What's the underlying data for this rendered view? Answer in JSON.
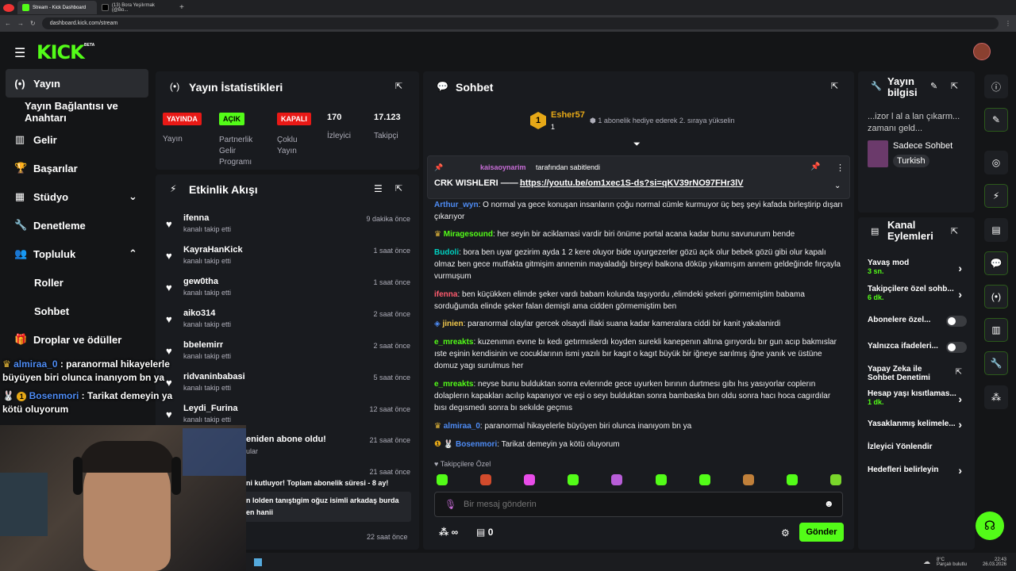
{
  "browser": {
    "tabs": [
      {
        "label": "Stream - Kick Dashboard"
      },
      {
        "label": "(13) Bora Yeşilırmak (@Bo..."
      }
    ],
    "url": "dashboard.kick.com/stream"
  },
  "header": {
    "logo": "KICK",
    "beta": "BETA"
  },
  "sidebar": {
    "items": [
      {
        "label": "Yayın",
        "icon": "broadcast-icon"
      },
      {
        "label": "Yayın Bağlantısı ve Anahtarı"
      },
      {
        "label": "Gelir",
        "icon": "chart-icon"
      },
      {
        "label": "Başarılar",
        "icon": "trophy-icon"
      },
      {
        "label": "Stüdyo",
        "icon": "layout-icon"
      },
      {
        "label": "Denetleme",
        "icon": "wrench-icon"
      },
      {
        "label": "Topluluk",
        "icon": "people-icon"
      },
      {
        "label": "Roller"
      },
      {
        "label": "Sohbet"
      },
      {
        "label": "Droplar ve ödüller",
        "icon": "gift-icon"
      }
    ]
  },
  "stats": {
    "title": "Yayın İstatistikleri",
    "items": [
      {
        "badge": "YAYINDA",
        "label": "Yayın"
      },
      {
        "badge": "AÇIK",
        "label": "Partnerlik Gelir Programı"
      },
      {
        "badge": "KAPALI",
        "label": "Çoklu Yayın"
      },
      {
        "value": "170",
        "label": "İzleyici"
      },
      {
        "value": "17.123",
        "label": "Takipçi"
      }
    ]
  },
  "activity": {
    "title": "Etkinlik Akışı",
    "items": [
      {
        "name": "ifenna",
        "sub": "kanalı takip etti",
        "time": "9 dakika önce"
      },
      {
        "name": "KayraHanKick",
        "sub": "kanalı takip etti",
        "time": "1 saat önce"
      },
      {
        "name": "gew0tha",
        "sub": "kanalı takip etti",
        "time": "1 saat önce"
      },
      {
        "name": "aiko314",
        "sub": "kanalı takip etti",
        "time": "2 saat önce"
      },
      {
        "name": "bbelemirr",
        "sub": "kanalı takip etti",
        "time": "2 saat önce"
      },
      {
        "name": "ridvaninbabasi",
        "sub": "kanalı takip etti",
        "time": "5 saat önce"
      },
      {
        "name": "Leydi_Furina",
        "sub": "kanalı takip etti",
        "time": "12 saat önce"
      },
      {
        "name": "eniden abone oldu!",
        "sub": "ular",
        "time": "21 saat önce"
      },
      {
        "name": "ni kutluyor! Toplam abonelik süresi - 8 ay!",
        "sub": "",
        "time": "21 saat önce"
      },
      {
        "name": "n lolden tanıştıgim oğuz isimli arkadaş burda",
        "sub": "en hanii",
        "time": ""
      },
      {
        "name": "",
        "sub": "",
        "time": "22 saat önce"
      }
    ]
  },
  "chat": {
    "title": "Sohbet",
    "top_gifter": {
      "rank": "1",
      "name": "Esher57",
      "count": "1",
      "hint": "1 abonelik hediye ederek 2. sıraya yükselin"
    },
    "pinned": {
      "by": "kaisaoynarim",
      "by_suffix": "tarafından sabitlendi",
      "text": "CRK WISHLERI ——→",
      "link": "https://youtu.be/om1xec1S-ds?si=qKV39rNO97FHr3lV"
    },
    "messages": [
      {
        "user": "Arthur_wyn",
        "color": "#4e8cf5",
        "text": "O normal ya gece konuşan insanların çoğu normal cümle kurmuyor üç beş şeyi kafada birleştirip dışarı çıkarıyor"
      },
      {
        "user": "Miragesound",
        "color": "#53fc18",
        "text": "her seyin bir aciklamasi vardir biri önüme portal acana kadar bunu savunurum bende"
      },
      {
        "user": "Budoli",
        "color": "#00d1c1",
        "text": "bora ben uyar gezirim ayda 1 2 kere oluyor bide uyurgezerler gözü açık olur bebek gözü gibi olur kapalı olmaz ben gece mutfakta gitmişim annemin mayaladığı birşeyi balkona döküp yıkamışım annem geldeğinde fırçayla vurmuşum"
      },
      {
        "user": "ifenna",
        "color": "#ff5b6e",
        "text": "ben küçükken elimde şeker vardı babam kolunda taşıyordu ,elimdeki şekeri görmemiştim babama sorduğumda elinde şeker falan demişti ama cidden görmemiştim ben"
      },
      {
        "user": "jinien",
        "color": "#f2c94c",
        "text": "paranormal olaylar gercek olsaydi illaki suana kadar kameralara ciddi bir kanit yakalanirdi"
      },
      {
        "user": "e_mreakts",
        "color": "#53fc18",
        "text": "kuzenımın evıne bı kedı getırmıslerdı koyden surekli kanepenın altına gırıyordu bır gun acıp bakmıslar ıste eşinin kendisinin ve cocuklarının ismi yazılı bır kagıt o kagıt büyük bir iğneye sarılmış iğne yanık ve üstüne domuz yagı surulmus her"
      },
      {
        "user": "e_mreakts",
        "color": "#53fc18",
        "text": "neyse bunu bulduktan sonra evlerınde gece uyurken bırının durtmesı gıbı hıs yasıyorlar coplerın dolaplerın kapakları acılıp kapanıyor ve eşi o seyı bulduktan sonra bambaska bırı oldu sonra hacı hoca cagırdılar bısı degısmedı sonra bı sekılde geçmıs"
      },
      {
        "user": "almiraa_0",
        "color": "#4e8cf5",
        "text": "paranormal hikayelerle büyüyen biri olunca inanıyom bn ya"
      },
      {
        "user": "Bosenmori",
        "color": "#4e8cf5",
        "text": "Tarikat demeyin ya kötü oluyorum"
      }
    ],
    "followers_only": "Takipçilere Özel",
    "input_placeholder": "Bir mesaj gönderin",
    "points": "∞",
    "store_count": "0",
    "send": "Gönder"
  },
  "stream_info": {
    "title": "Yayın bilgisi",
    "stream_title": "...izor l al a lan çıkarm... zamanı geld...",
    "category": "Sadece Sohbet",
    "tag": "Turkish"
  },
  "actions": {
    "title": "Kanal Eylemleri",
    "items": [
      {
        "label": "Yavaş mod",
        "sub": "3 sn."
      },
      {
        "label": "Takipçilere özel sohb...",
        "sub": "6 dk."
      },
      {
        "label": "Abonelere özel..."
      },
      {
        "label": "Yalnızca ifadeleri..."
      },
      {
        "label": "Yapay Zeka ile Sohbet Denetimi"
      },
      {
        "label": "Hesap yaşı kısıtlamas...",
        "sub": "1 dk."
      },
      {
        "label": "Yasaklanmış kelimele..."
      },
      {
        "label": "İzleyici Yönlendir"
      },
      {
        "label": "Hedefleri belirleyin"
      }
    ]
  },
  "overlay": {
    "line1_user": "almiraa_0",
    "line1_text": ": paranormal hikayelerle büyüyen biri olunca inanıyom bn ya",
    "line2_user": "Bosenmori",
    "line2_text": ": Tarikat demeyin ya kötü oluyorum",
    "badge_num": "1"
  },
  "taskbar": {
    "weather": "8°C",
    "weather_sub": "Parçalı bulutlu",
    "time": "22:43",
    "date": "26.03.2026"
  },
  "colors": {
    "accent": "#53fc18",
    "bg": "#141517",
    "panel": "#191b1f",
    "live": "#e91916"
  }
}
